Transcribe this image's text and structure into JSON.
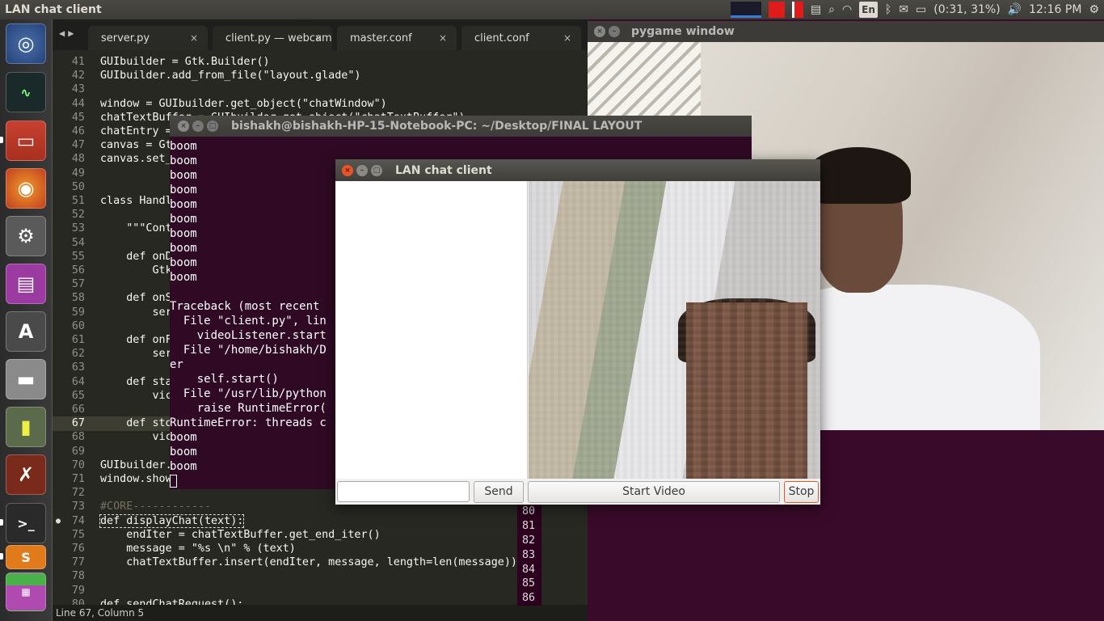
{
  "top_panel": {
    "app_title": "LAN chat client",
    "language": "En",
    "battery": "(0:31, 31%)",
    "clock": "12:16 PM"
  },
  "launcher": {
    "items": [
      "ubuntu-dash",
      "system-monitor",
      "files",
      "firefox",
      "system-settings",
      "unity-tweak",
      "software-updater",
      "disk",
      "power-statistics",
      "gimp",
      "terminal",
      "sublime-text",
      "workspace-switcher"
    ]
  },
  "editor": {
    "tabs": [
      {
        "label": "server.py",
        "close": "×"
      },
      {
        "label": "client.py — webcam",
        "close": "×"
      },
      {
        "label": "master.conf",
        "close": "×"
      },
      {
        "label": "client.conf",
        "close": "×"
      }
    ],
    "lines": [
      {
        "n": "41",
        "code": "GUIbuilder = Gtk.Builder()"
      },
      {
        "n": "42",
        "code": "GUIbuilder.add_from_file(\"layout.glade\")"
      },
      {
        "n": "43",
        "code": ""
      },
      {
        "n": "44",
        "code": "window = GUIbuilder.get_object(\"chatWindow\")"
      },
      {
        "n": "45",
        "code": "chatTextBuffer = GUIbuilder.get_object(\"chatTextBuffer\")"
      },
      {
        "n": "46",
        "code": "chatEntry = Gt"
      },
      {
        "n": "47",
        "code": "canvas = Gt"
      },
      {
        "n": "48",
        "code": "canvas.set_"
      },
      {
        "n": "49",
        "code": ""
      },
      {
        "n": "50",
        "code": ""
      },
      {
        "n": "51",
        "code": "class Handl"
      },
      {
        "n": "52",
        "code": ""
      },
      {
        "n": "53",
        "code": "    \"\"\"Cont"
      },
      {
        "n": "54",
        "code": ""
      },
      {
        "n": "55",
        "code": "    def onD"
      },
      {
        "n": "56",
        "code": "        Gtk"
      },
      {
        "n": "57",
        "code": ""
      },
      {
        "n": "58",
        "code": "    def onS"
      },
      {
        "n": "59",
        "code": "        ser"
      },
      {
        "n": "60",
        "code": ""
      },
      {
        "n": "61",
        "code": "    def onF"
      },
      {
        "n": "62",
        "code": "        ser"
      },
      {
        "n": "63",
        "code": ""
      },
      {
        "n": "64",
        "code": "    def sta"
      },
      {
        "n": "65",
        "code": "        vic"
      },
      {
        "n": "66",
        "code": ""
      },
      {
        "n": "67",
        "code": "    def sto"
      },
      {
        "n": "68",
        "code": "        vic"
      },
      {
        "n": "69",
        "code": ""
      },
      {
        "n": "70",
        "code": "GUIbuilder."
      },
      {
        "n": "71",
        "code": "window.show"
      },
      {
        "n": "72",
        "code": ""
      },
      {
        "n": "73",
        "code": "#CORE------------"
      },
      {
        "n": "74",
        "code": "def displayChat(text):"
      },
      {
        "n": "75",
        "code": "    endIter = chatTextBuffer.get_end_iter()"
      },
      {
        "n": "76",
        "code": "    message = \"%s \\n\" % (text)"
      },
      {
        "n": "77",
        "code": "    chatTextBuffer.insert(endIter, message, length=len(message))"
      },
      {
        "n": "78",
        "code": ""
      },
      {
        "n": "79",
        "code": ""
      },
      {
        "n": "80",
        "code": "def sendChatRequest():"
      }
    ],
    "status": "Line 67, Column 5",
    "right_gutter": [
      "80",
      "81",
      "82",
      "83",
      "84",
      "85",
      "86"
    ]
  },
  "pygame_window": {
    "title": "pygame window"
  },
  "terminal": {
    "title": "bishakh@bishakh-HP-15-Notebook-PC: ~/Desktop/FINAL LAYOUT",
    "lines": [
      "boom",
      "boom",
      "boom",
      "boom",
      "boom",
      "boom",
      "boom",
      "boom",
      "boom",
      "boom",
      "",
      "Traceback (most recent",
      "  File \"client.py\", lin",
      "    videoListener.start",
      "  File \"/home/bishakh/D",
      "er",
      "    self.start()",
      "  File \"/usr/lib/python",
      "    raise RuntimeError(",
      "RuntimeError: threads c",
      "boom",
      "boom",
      "boom"
    ]
  },
  "chat_window": {
    "title": "LAN chat client",
    "entry_value": "",
    "send_label": "Send",
    "start_video_label": "Start Video",
    "stop_label": "Stop"
  }
}
